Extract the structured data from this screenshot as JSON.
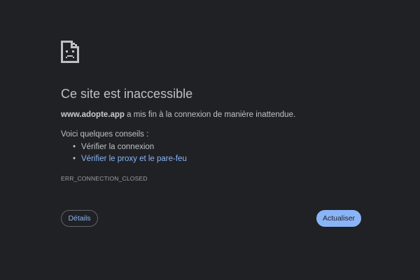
{
  "error_page": {
    "icon": "sad-file-icon",
    "title": "Ce site est inaccessible",
    "host": "www.adopte.app",
    "message_rest": " a mis fin à la connexion de manière inattendue.",
    "tips_heading": "Voici quelques conseils :",
    "tips": [
      {
        "label": "Vérifier la connexion",
        "is_link": false
      },
      {
        "label": "Vérifier le proxy et le pare-feu",
        "is_link": true
      }
    ],
    "error_code": "ERR_CONNECTION_CLOSED",
    "details_button": "Détails",
    "reload_button": "Actualiser"
  },
  "colors": {
    "background": "#202124",
    "text": "#bdc1c6",
    "link": "#8ab4f8",
    "primary_button": "#8ab4f8"
  }
}
